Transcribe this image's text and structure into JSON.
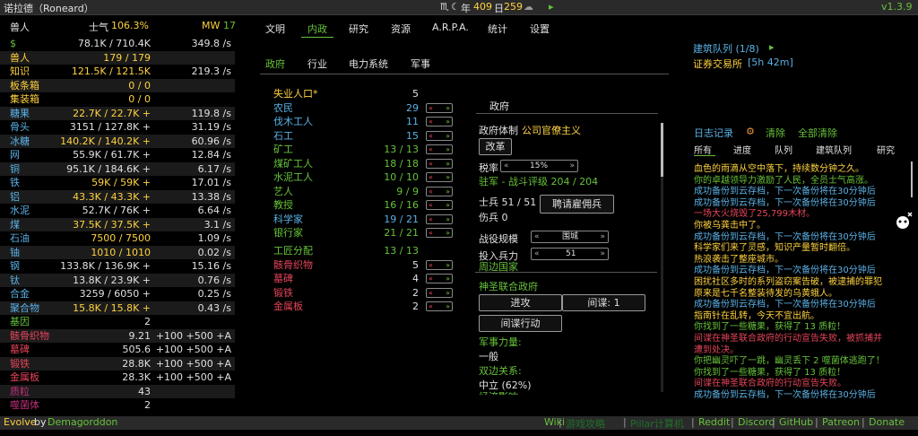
{
  "top": {
    "city": "诺拉德（Roneard）",
    "sign": "♏",
    "moon": "☾",
    "year_label": "年",
    "year": "409",
    "day_label": "日",
    "day": "259",
    "weather": "☁",
    "play": "▸",
    "version": "v1.3.9"
  },
  "header": {
    "species": "兽人",
    "morale_label": "士气",
    "morale": "106.3%",
    "power_label": "MW",
    "power": "17"
  },
  "resources": [
    {
      "name": "$",
      "value": "78.1K / 710.4K",
      "rate": "349.8 /s",
      "color": "#67c23a",
      "vcolor": "#e0e0e0"
    },
    {
      "name": "兽人",
      "value": "179 / 179",
      "rate": "",
      "color": "#ffd23f",
      "vcolor": "#ffd23f"
    },
    {
      "name": "知识",
      "value": "121.5K / 121.5K",
      "rate": "219.3 /s",
      "color": "#ffd23f",
      "vcolor": "#ffd23f"
    },
    {
      "name": "板条箱",
      "value": "0 / 0",
      "rate": "",
      "color": "#ffd23f",
      "vcolor": "#ffd23f"
    },
    {
      "name": "集装箱",
      "value": "0 / 0",
      "rate": "",
      "color": "#ffd23f",
      "vcolor": "#ffd23f"
    },
    {
      "name": "糖果",
      "value": "22.7K / 22.7K +",
      "rate": "119.8 /s",
      "color": "#5ab1e6",
      "vcolor": "#ffd23f"
    },
    {
      "name": "骨头",
      "value": "3151 / 127.8K +",
      "rate": "31.19 /s",
      "color": "#5ab1e6",
      "vcolor": "#e0e0e0"
    },
    {
      "name": "冰糖",
      "value": "140.2K / 140.2K +",
      "rate": "60.96 /s",
      "color": "#5ab1e6",
      "vcolor": "#ffd23f"
    },
    {
      "name": "网",
      "value": "55.9K / 61.7K +",
      "rate": "12.84 /s",
      "color": "#5ab1e6",
      "vcolor": "#e0e0e0"
    },
    {
      "name": "铜",
      "value": "95.1K / 184.6K +",
      "rate": "6.17 /s",
      "color": "#5ab1e6",
      "vcolor": "#e0e0e0"
    },
    {
      "name": "铁",
      "value": "59K / 59K +",
      "rate": "17.01 /s",
      "color": "#5ab1e6",
      "vcolor": "#ffd23f"
    },
    {
      "name": "铝",
      "value": "43.3K / 43.3K +",
      "rate": "13.38 /s",
      "color": "#5ab1e6",
      "vcolor": "#ffd23f"
    },
    {
      "name": "水泥",
      "value": "52.7K / 76K +",
      "rate": "6.64 /s",
      "color": "#5ab1e6",
      "vcolor": "#e0e0e0"
    },
    {
      "name": "煤",
      "value": "37.5K / 37.5K +",
      "rate": "3.1 /s",
      "color": "#5ab1e6",
      "vcolor": "#ffd23f"
    },
    {
      "name": "石油",
      "value": "7500 / 7500",
      "rate": "1.09 /s",
      "color": "#5ab1e6",
      "vcolor": "#ffd23f"
    },
    {
      "name": "铀",
      "value": "1010 / 1010",
      "rate": "0.02 /s",
      "color": "#5ab1e6",
      "vcolor": "#ffd23f"
    },
    {
      "name": "钢",
      "value": "133.8K / 136.9K +",
      "rate": "15.16 /s",
      "color": "#5ab1e6",
      "vcolor": "#e0e0e0"
    },
    {
      "name": "钛",
      "value": "13.8K / 23.9K +",
      "rate": "0.76 /s",
      "color": "#5ab1e6",
      "vcolor": "#e0e0e0"
    },
    {
      "name": "合金",
      "value": "3259 / 6050 +",
      "rate": "0.25 /s",
      "color": "#5ab1e6",
      "vcolor": "#e0e0e0"
    },
    {
      "name": "聚合物",
      "value": "15.8K / 15.8K +",
      "rate": "0.43 /s",
      "color": "#5ab1e6",
      "vcolor": "#ffd23f"
    },
    {
      "name": "基因",
      "value": "2",
      "rate": "",
      "color": "#67c23a",
      "vcolor": "#e0e0e0"
    },
    {
      "name": "骸骨织物",
      "value": "9.21",
      "rate": "+100 +500 +A",
      "color": "#e6455a",
      "vcolor": "#e0e0e0"
    },
    {
      "name": "墓碑",
      "value": "505.6",
      "rate": "+100 +500 +A",
      "color": "#e6455a",
      "vcolor": "#e0e0e0"
    },
    {
      "name": "锻铁",
      "value": "28.8K",
      "rate": "+100 +500 +A",
      "color": "#e6455a",
      "vcolor": "#e0e0e0"
    },
    {
      "name": "金属板",
      "value": "28.3K",
      "rate": "+100 +500 +A",
      "color": "#e6455a",
      "vcolor": "#e0e0e0"
    },
    {
      "name": "质粒",
      "value": "43",
      "rate": "",
      "color": "#c0307a",
      "vcolor": "#e0e0e0"
    },
    {
      "name": "噬菌体",
      "value": "2",
      "rate": "",
      "color": "#c0307a",
      "vcolor": "#e0e0e0"
    }
  ],
  "main_tabs": [
    "文明",
    "内政",
    "研究",
    "资源",
    "A.R.P.A.",
    "统计",
    "设置"
  ],
  "sub_tabs": [
    "政府",
    "行业",
    "电力系统",
    "军事"
  ],
  "jobs": [
    {
      "name": "失业人口*",
      "count": "5",
      "color": "#ffd23f",
      "ctl": false
    },
    {
      "name": "农民",
      "count": "29",
      "color": "#5ab1e6",
      "ctl": true
    },
    {
      "name": "伐木工人",
      "count": "11",
      "color": "#5ab1e6",
      "ctl": true
    },
    {
      "name": "石工",
      "count": "15",
      "color": "#5ab1e6",
      "ctl": true
    },
    {
      "name": "矿工",
      "count": "13 / 13",
      "color": "#67c23a",
      "ctl": true
    },
    {
      "name": "煤矿工人",
      "count": "18 / 18",
      "color": "#67c23a",
      "ctl": true
    },
    {
      "name": "水泥工人",
      "count": "10 / 10",
      "color": "#67c23a",
      "ctl": true
    },
    {
      "name": "艺人",
      "count": "9 / 9",
      "color": "#67c23a",
      "ctl": true
    },
    {
      "name": "教授",
      "count": "16 / 16",
      "color": "#67c23a",
      "ctl": true
    },
    {
      "name": "科学家",
      "count": "19 / 21",
      "color": "#5ab1e6",
      "ctl": true
    },
    {
      "name": "银行家",
      "count": "21 / 21",
      "color": "#67c23a",
      "ctl": true
    }
  ],
  "crafting": {
    "title": "工匠分配",
    "count": "13 / 13",
    "items": [
      {
        "name": "骸骨织物",
        "count": "5"
      },
      {
        "name": "墓碑",
        "count": "4"
      },
      {
        "name": "锻铁",
        "count": "2"
      },
      {
        "name": "金属板",
        "count": "2"
      }
    ]
  },
  "control": {
    "minus": "«",
    "plus": "»"
  },
  "gov": {
    "header": "政府",
    "system_label": "政府体制",
    "system": "公司官僚主义",
    "reform": "改革",
    "tax_label": "税率",
    "tax": "15%",
    "garrison": "驻军 - 战斗评级 204 / 204",
    "soldiers": "士兵 51 / 51",
    "wounded": "伤兵 0",
    "hire": "聘请雇佣兵",
    "campaign_label": "战役规模",
    "campaign": "围城",
    "troops_label": "投入兵力",
    "troops": "51",
    "neighbors": "周边国家",
    "nation": "神圣联合政府",
    "attack": "进攻",
    "spy": "间谍: 1",
    "espionage": "间谍行动",
    "mil_label": "军事力量:",
    "mil": "一般",
    "rel_label": "双边关系:",
    "rel": "中立 (62%)",
    "cut": "经济影响:"
  },
  "queue": {
    "label": "建筑队列 (1/8)",
    "play": "▸",
    "building": "证券交易所",
    "time": "[5h 42m]"
  },
  "log": {
    "title": "日志记录",
    "gear": "⚙",
    "clear": "清除",
    "clear_all": "全部清除",
    "tabs": [
      "所有",
      "进度",
      "队列",
      "建筑队列",
      "研究"
    ],
    "messages": [
      {
        "t": "血色的雨滴从空中落下，持续数分钟之久。",
        "c": "#ffd23f"
      },
      {
        "t": "你的卓越领导力激励了人民，全员士气高涨。",
        "c": "#67c23a"
      },
      {
        "t": "成功备份到云存档，下一次备份将在30分钟后",
        "c": "#5ab1e6"
      },
      {
        "t": "成功备份到云存档，下一次备份将在30分钟后",
        "c": "#5ab1e6"
      },
      {
        "t": "一场大火烧毁了25,799木材。",
        "c": "#e6455a"
      },
      {
        "t": "你被乌龚击中了。",
        "c": "#ffd23f"
      },
      {
        "t": "成功备份到云存档，下一次备份将在30分钟后",
        "c": "#5ab1e6"
      },
      {
        "t": "科学家们来了灵感，知识产量暂时翻倍。",
        "c": "#ffd23f"
      },
      {
        "t": "热浪袭击了整座城市。",
        "c": "#ffd23f"
      },
      {
        "t": "成功备份到云存档，下一次备份将在30分钟后",
        "c": "#5ab1e6"
      },
      {
        "t": "困扰社区多时的系列盗窃案告破，被逮捕的罪犯",
        "c": "#ffd23f"
      },
      {
        "t": "原来是七千名整装待发的乌黄蛾人。",
        "c": "#ffd23f"
      },
      {
        "t": "成功备份到云存档，下一次备份将在30分钟后",
        "c": "#5ab1e6"
      },
      {
        "t": "指南针在乱转，今天不宜出航。",
        "c": "#ffd23f"
      },
      {
        "t": "你找到了一些糖果，获得了 13 质粒！",
        "c": "#67c23a"
      },
      {
        "t": "间谍在神圣联合政府的行动宣告失败，被抓捕并",
        "c": "#e6455a"
      },
      {
        "t": "遭到处决。",
        "c": "#e6455a"
      },
      {
        "t": "你把幽灵吓了一跳，幽灵丢下 2 噬菌体逃跑了！",
        "c": "#67c23a"
      },
      {
        "t": "你找到了一些糖果，获得了 13 质粒！",
        "c": "#67c23a"
      },
      {
        "t": "间谍在神圣联合政府的行动宣告失败。",
        "c": "#e6455a"
      },
      {
        "t": "成功备份到云存档，下一次备份将在30分钟后",
        "c": "#5ab1e6"
      }
    ]
  },
  "footer": {
    "game": "Evolve",
    "by": "by",
    "author": "Demagorddon",
    "links": [
      "Wiki",
      "游戏攻略",
      "Pillar计算机",
      "Reddit",
      "Discord",
      "GitHub",
      "Patreon",
      "Donate"
    ],
    "sep": "|"
  }
}
